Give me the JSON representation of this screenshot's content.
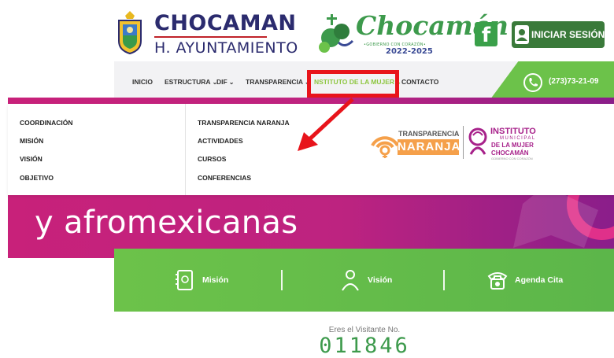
{
  "header": {
    "brand_title": "CHOCAMAN",
    "brand_subtitle": "H. AYUNTAMIENTO",
    "gov_logo_script": "Chocamán",
    "gov_logo_tagline": "•GOBIERNO CON CORAZÓN•",
    "gov_logo_years": "2022-2025",
    "login_label": "INICIAR SESIÓN"
  },
  "nav": {
    "items": [
      {
        "label": "INICIO",
        "dropdown": false
      },
      {
        "label": "ESTRUCTURA",
        "dropdown": true
      },
      {
        "label": "DIF",
        "dropdown": true
      },
      {
        "label": "TRANSPARENCIA",
        "dropdown": true
      },
      {
        "label": "NSTITUTO DE LA MUJER",
        "dropdown": true
      },
      {
        "label": "CONTACTO",
        "dropdown": false
      }
    ],
    "phone": "(273)73-21-09"
  },
  "dropdown": {
    "col1": [
      "COORDINACIÓN",
      "MISIÓN",
      "VISIÓN",
      "OBJETIVO"
    ],
    "col2": [
      "TRANSPARENCIA NARANJA",
      "ACTIVIDADES",
      "CURSOS",
      "CONFERENCIAS"
    ],
    "transparencia_logo": {
      "top": "TRANSPARENCIA",
      "bottom": "NARANJA"
    },
    "instituto_logo": {
      "line1": "INSTITUTO",
      "line2": "MUNICIPAL",
      "line3": "DE LA MUJER",
      "line4": "CHOCAMÁN",
      "line5": "GOBIERNO CON CORAZÓN"
    }
  },
  "hero": {
    "text": "y afromexicanas"
  },
  "quick_links": [
    {
      "label": "Misión",
      "icon": "notebook-icon"
    },
    {
      "label": "Visión",
      "icon": "person-icon"
    },
    {
      "label": "Agenda Cita",
      "icon": "telephone-icon"
    }
  ],
  "visitor": {
    "label": "Eres el Visitante No.",
    "count": "011846"
  },
  "colors": {
    "green": "#6cc24a",
    "magenta": "#c8217a",
    "navy": "#2b2b6e",
    "highlight_red": "#e8141b"
  }
}
